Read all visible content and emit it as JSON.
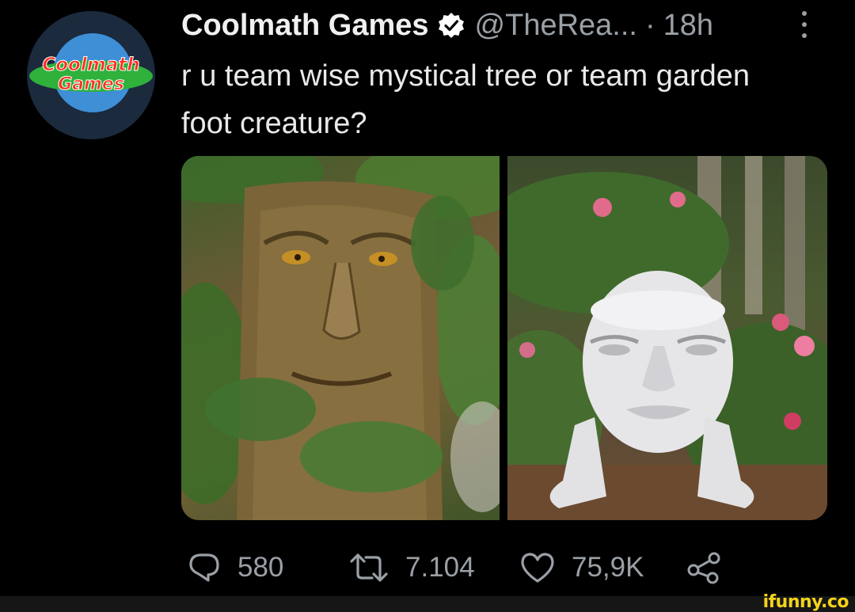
{
  "account": {
    "display_name": "Coolmath Games",
    "handle": "@TheRea...",
    "separator": "·",
    "time": "18h",
    "avatar_logo_lines": [
      "Coolmath",
      "Games"
    ]
  },
  "tweet": {
    "text": "r u team wise mystical tree or team garden foot creature?"
  },
  "media": [
    {
      "description_name": "wise-mystical-tree-image"
    },
    {
      "description_name": "garden-foot-creature-image"
    }
  ],
  "actions": {
    "replies": "580",
    "retweets": "7.104",
    "likes": "75,9K"
  },
  "watermark": "ifunny.co",
  "colors": {
    "background": "#000000",
    "text": "#e7e9ea",
    "muted": "#9aa0a6",
    "verified": "#ffffff",
    "watermark": "#f3d31a"
  },
  "icons": {
    "verified": "verified-badge-icon",
    "more": "more-vertical-icon",
    "reply": "reply-icon",
    "retweet": "retweet-icon",
    "like": "heart-icon",
    "share": "share-icon"
  }
}
